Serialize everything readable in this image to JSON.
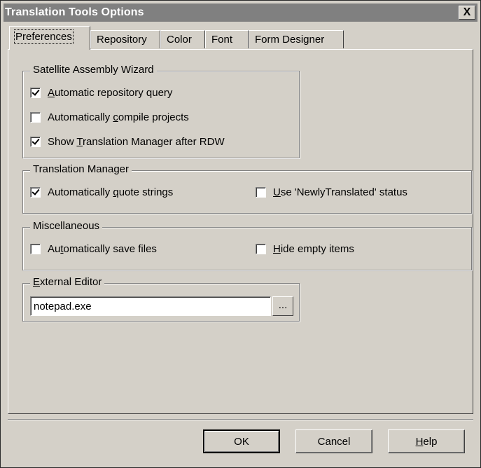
{
  "window": {
    "title": "Translation Tools Options",
    "close_glyph": "X"
  },
  "tabs": [
    {
      "label": "Preferences",
      "active": true
    },
    {
      "label": "Repository",
      "active": false
    },
    {
      "label": "Color",
      "active": false
    },
    {
      "label": "Font",
      "active": false
    },
    {
      "label": "Form Designer",
      "active": false
    }
  ],
  "satellite": {
    "legend": "Satellite Assembly Wizard",
    "items": [
      {
        "pre": "",
        "key": "A",
        "post": "utomatic repository query",
        "checked": true
      },
      {
        "pre": "Automatically ",
        "key": "c",
        "post": "ompile projects",
        "checked": false
      },
      {
        "pre": "Show ",
        "key": "T",
        "post": "ranslation Manager after RDW",
        "checked": true
      }
    ]
  },
  "translation_manager": {
    "legend": "Translation Manager",
    "items": [
      {
        "pre": "Automatically ",
        "key": "q",
        "post": "uote strings",
        "checked": true
      },
      {
        "pre": "",
        "key": "U",
        "post": "se 'NewlyTranslated' status",
        "checked": false
      }
    ]
  },
  "misc": {
    "legend": "Miscellaneous",
    "items": [
      {
        "pre": "Au",
        "key": "t",
        "post": "omatically save files",
        "checked": false
      },
      {
        "pre": "",
        "key": "H",
        "post": "ide empty items",
        "checked": false
      }
    ]
  },
  "external_editor": {
    "legend_key": "E",
    "legend_rest": "xternal Editor",
    "value": "notepad.exe",
    "browse_label": "..."
  },
  "buttons": {
    "ok": "OK",
    "cancel": "Cancel",
    "help_key": "H",
    "help_rest": "elp"
  }
}
